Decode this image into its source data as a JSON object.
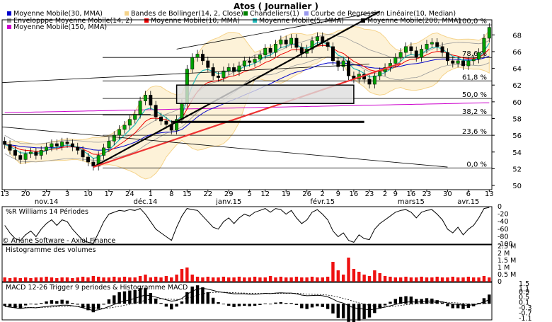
{
  "title": "Atos  ( Journalier )",
  "legend": [
    {
      "label": "Moyenne Mobile(30, MMA)",
      "color": "#0000cc"
    },
    {
      "label": "Bandes de Bollinger(14, 2, Close)",
      "color": "#f5d38a"
    },
    {
      "label": "Chandeliers(1)",
      "color": "#008000"
    },
    {
      "label": "Courbe de Regression Linéaire(10, Median)",
      "color": "#9999ee"
    },
    {
      "label": "Envelopppe Moyenne Mobile(14, 2)",
      "color": "#999999"
    },
    {
      "label": "Moyenne Mobile(10, MMA)",
      "color": "#ee0000"
    },
    {
      "label": "Moyenne Mobile(5, MMA)",
      "color": "#22bbbb"
    },
    {
      "label": "Moyenne Mobile(200, MMA)",
      "color": "#000000"
    },
    {
      "label": "Moyenne Mobile(150, MMA)",
      "color": "#cc00cc"
    }
  ],
  "chart_data": [
    {
      "type": "candlestick",
      "panel": "price",
      "y_ticks": [
        50,
        52,
        54,
        56,
        58,
        60,
        62,
        64,
        66,
        68
      ],
      "ylim": [
        49.5,
        69.8
      ],
      "fib_levels": [
        {
          "label": "100,0 %",
          "value": 69.2
        },
        {
          "label": "78,6 %",
          "value": 65.3
        },
        {
          "label": "61,8 %",
          "value": 62.5
        },
        {
          "label": "50,0 %",
          "value": 60.4
        },
        {
          "label": "38,2 %",
          "value": 58.4
        },
        {
          "label": "23,6 %",
          "value": 56.0
        },
        {
          "label": "0,0 %",
          "value": 52.1
        }
      ],
      "x_day_ticks": [
        "13",
        "20",
        "27",
        "3",
        "10",
        "17",
        "24",
        "1",
        "8",
        "15",
        "22",
        "29",
        "5",
        "12",
        "19",
        "26",
        "2",
        "9",
        "16",
        "23",
        "2",
        "9",
        "16",
        "23",
        "30",
        "6",
        "13"
      ],
      "x_month_labels": [
        "nov.14",
        "déc.14",
        "janv.15",
        "févr.15",
        "mars15",
        "avr.15"
      ],
      "close": [
        54.9,
        54.2,
        53.6,
        53.1,
        53.8,
        54.0,
        53.6,
        54.2,
        54.6,
        55.0,
        54.7,
        55.2,
        55.0,
        54.6,
        54.2,
        53.4,
        52.8,
        52.3,
        53.6,
        54.5,
        55.3,
        56.0,
        56.7,
        57.2,
        57.9,
        58.5,
        60.1,
        60.8,
        59.6,
        58.2,
        57.7,
        57.3,
        56.6,
        57.9,
        59.8,
        63.9,
        65.3,
        65.7,
        64.9,
        64.1,
        63.1,
        62.9,
        63.7,
        64.1,
        63.6,
        64.3,
        64.9,
        64.7,
        65.1,
        65.6,
        66.4,
        65.9,
        66.9,
        67.4,
        66.9,
        67.6,
        66.5,
        65.8,
        66.3,
        67.3,
        67.8,
        67.1,
        66.6,
        64.9,
        64.2,
        64.9,
        63.1,
        62.7,
        63.3,
        62.7,
        62.1,
        63.1,
        63.6,
        64.1,
        64.6,
        65.3,
        65.9,
        66.6,
        66.1,
        65.3,
        66.3,
        66.9,
        67.1,
        66.6,
        65.9,
        64.9,
        64.6,
        64.9,
        64.3,
        64.9,
        65.1,
        65.9,
        67.6,
        68.9
      ]
    },
    {
      "type": "line",
      "panel": "williams",
      "title": "%R Williams 14 Périodes",
      "y_ticks": [
        0,
        -20,
        -40,
        -60,
        -80,
        -100
      ],
      "ylim": [
        -100,
        0
      ],
      "values": [
        -50,
        -70,
        -85,
        -90,
        -75,
        -65,
        -80,
        -60,
        -45,
        -35,
        -50,
        -35,
        -40,
        -60,
        -75,
        -90,
        -95,
        -98,
        -70,
        -40,
        -20,
        -15,
        -10,
        -12,
        -8,
        -10,
        -5,
        -20,
        -40,
        -60,
        -70,
        -80,
        -90,
        -55,
        -25,
        -5,
        -8,
        -10,
        -25,
        -40,
        -55,
        -60,
        -40,
        -30,
        -45,
        -30,
        -20,
        -25,
        -15,
        -10,
        -5,
        -15,
        -5,
        -8,
        -20,
        -10,
        -30,
        -45,
        -35,
        -15,
        -8,
        -20,
        -35,
        -65,
        -80,
        -70,
        -90,
        -95,
        -75,
        -85,
        -88,
        -60,
        -45,
        -35,
        -25,
        -15,
        -10,
        -8,
        -15,
        -30,
        -15,
        -10,
        -8,
        -20,
        -35,
        -60,
        -70,
        -55,
        -75,
        -60,
        -50,
        -30,
        -5,
        -2
      ]
    },
    {
      "type": "bar",
      "panel": "volume",
      "title": "Histogramme des volumes",
      "y_tick_labels": [
        "2.5 M",
        "2 M",
        "1.5 M",
        "1 M",
        "0.5 M",
        "0"
      ],
      "y_tick_values": [
        2.5,
        2,
        1.5,
        1,
        0.5,
        0
      ],
      "ylim": [
        0,
        2.6
      ],
      "values": [
        0.3,
        0.25,
        0.3,
        0.25,
        0.3,
        0.25,
        0.3,
        0.3,
        0.35,
        0.3,
        0.25,
        0.3,
        0.3,
        0.25,
        0.3,
        0.35,
        0.3,
        0.4,
        0.35,
        0.3,
        0.3,
        0.35,
        0.3,
        0.35,
        0.3,
        0.3,
        0.4,
        0.5,
        0.3,
        0.35,
        0.3,
        0.4,
        0.3,
        0.5,
        0.9,
        1.0,
        0.5,
        0.35,
        0.3,
        0.35,
        0.3,
        0.3,
        0.35,
        0.3,
        0.3,
        0.35,
        0.3,
        0.3,
        0.35,
        0.3,
        0.3,
        0.4,
        0.3,
        0.35,
        0.3,
        0.3,
        0.35,
        0.3,
        0.3,
        0.35,
        0.3,
        0.3,
        0.35,
        1.4,
        0.8,
        0.5,
        1.7,
        0.9,
        0.7,
        0.5,
        0.4,
        0.8,
        0.6,
        0.4,
        0.35,
        0.3,
        0.3,
        0.35,
        0.3,
        0.3,
        0.35,
        0.3,
        0.3,
        0.35,
        0.3,
        0.3,
        0.35,
        0.3,
        0.3,
        0.35,
        0.3,
        0.3,
        0.4,
        0.3
      ]
    },
    {
      "type": "line",
      "panel": "macd",
      "title": "MACD 12-26   Trigger 9 periodes & Histogramme MACD",
      "y_tick_labels": [
        "1.5",
        "1.1",
        "0.9",
        "0.5",
        "0.1",
        "-0.3",
        "-0.7",
        "-1.1"
      ],
      "y_tick_values": [
        1.5,
        1.1,
        0.9,
        0.5,
        0.1,
        -0.3,
        -0.7,
        -1.1
      ],
      "ylim": [
        -1.2,
        1.6
      ],
      "macd": [
        -0.2,
        -0.25,
        -0.3,
        -0.35,
        -0.3,
        -0.28,
        -0.3,
        -0.25,
        -0.2,
        -0.15,
        -0.15,
        -0.1,
        -0.1,
        -0.15,
        -0.2,
        -0.3,
        -0.4,
        -0.5,
        -0.45,
        -0.35,
        -0.2,
        -0.05,
        0.1,
        0.2,
        0.3,
        0.4,
        0.55,
        0.65,
        0.6,
        0.5,
        0.4,
        0.3,
        0.2,
        0.25,
        0.4,
        0.7,
        0.95,
        1.1,
        1.15,
        1.1,
        1.0,
        0.9,
        0.85,
        0.8,
        0.75,
        0.75,
        0.75,
        0.72,
        0.72,
        0.74,
        0.78,
        0.76,
        0.8,
        0.82,
        0.8,
        0.8,
        0.75,
        0.65,
        0.6,
        0.62,
        0.64,
        0.6,
        0.52,
        0.35,
        0.15,
        0.05,
        -0.15,
        -0.3,
        -0.35,
        -0.4,
        -0.45,
        -0.4,
        -0.32,
        -0.25,
        -0.15,
        -0.05,
        0.05,
        0.12,
        0.15,
        0.12,
        0.15,
        0.2,
        0.22,
        0.2,
        0.15,
        0.05,
        -0.02,
        -0.05,
        -0.1,
        -0.1,
        -0.08,
        0.0,
        0.15,
        0.3
      ],
      "trigger": [
        -0.15,
        -0.18,
        -0.2,
        -0.24,
        -0.26,
        -0.27,
        -0.28,
        -0.27,
        -0.26,
        -0.24,
        -0.22,
        -0.2,
        -0.18,
        -0.17,
        -0.18,
        -0.2,
        -0.24,
        -0.29,
        -0.32,
        -0.33,
        -0.31,
        -0.26,
        -0.19,
        -0.11,
        -0.03,
        0.06,
        0.16,
        0.26,
        0.33,
        0.37,
        0.38,
        0.37,
        0.34,
        0.32,
        0.34,
        0.41,
        0.52,
        0.64,
        0.74,
        0.81,
        0.85,
        0.86,
        0.86,
        0.85,
        0.83,
        0.81,
        0.8,
        0.78,
        0.77,
        0.77,
        0.77,
        0.77,
        0.77,
        0.78,
        0.78,
        0.78,
        0.78,
        0.76,
        0.73,
        0.71,
        0.7,
        0.68,
        0.65,
        0.59,
        0.5,
        0.41,
        0.3,
        0.18,
        0.07,
        -0.02,
        -0.11,
        -0.17,
        -0.2,
        -0.21,
        -0.2,
        -0.17,
        -0.12,
        -0.07,
        -0.03,
        0.0,
        0.03,
        0.06,
        0.09,
        0.11,
        0.12,
        0.11,
        0.09,
        0.06,
        0.03,
        0.0,
        -0.02,
        -0.02,
        0.01,
        0.07
      ]
    }
  ],
  "footer": "© Ariane Software - Axial Finance"
}
